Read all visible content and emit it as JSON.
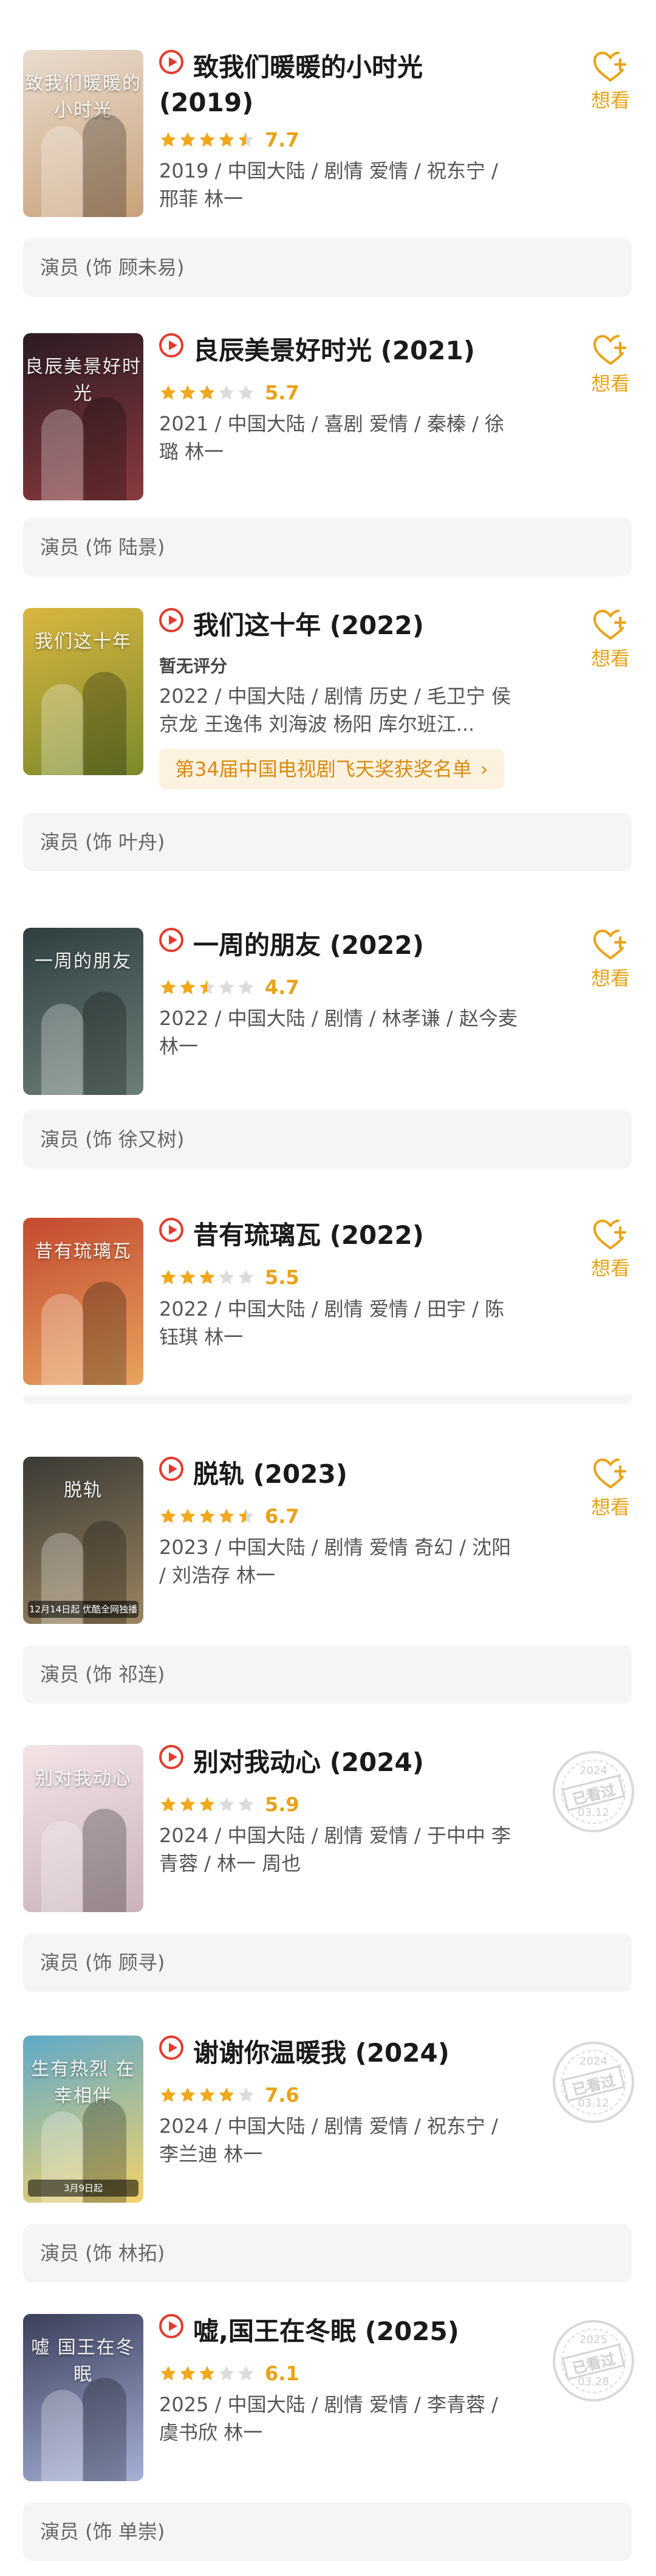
{
  "want_label": "想看",
  "items": [
    {
      "title": "致我们暖暖的小时光(2019)",
      "stars": [
        1,
        1,
        1,
        1,
        0.5
      ],
      "score": "7.7",
      "meta": "2019 / 中国大陆 / 剧情 爱情 / 祝东宁 / 邢菲 林一",
      "status": "want",
      "role": "演员 (饰 顾未易)",
      "poster_colors": [
        "#e9dccf",
        "#c9a27a"
      ],
      "poster_text": "致我们暖暖的小时光"
    },
    {
      "title": "良辰美景好时光 (2021)",
      "stars": [
        1,
        1,
        1,
        0,
        0
      ],
      "score": "5.7",
      "meta": "2021 / 中国大陆 / 喜剧 爱情 / 秦榛 / 徐璐 林一",
      "status": "want",
      "role": "演员 (饰 陆景)",
      "poster_colors": [
        "#2b1b22",
        "#8a3a3f"
      ],
      "poster_text": "良辰美景好时光"
    },
    {
      "title": "我们这十年 (2022)",
      "no_score": "暂无评分",
      "meta": "2022 / 中国大陆 / 剧情 历史 / 毛卫宁 侯京龙 王逸伟 刘海波 杨阳 库尔班江...",
      "award": "第34届中国电视剧飞天奖获奖名单",
      "status": "want",
      "role": "演员 (饰 叶舟)",
      "poster_colors": [
        "#d9b640",
        "#7a8a2a"
      ],
      "poster_text": "我们这十年"
    },
    {
      "title": "一周的朋友 (2022)",
      "stars": [
        1,
        1,
        0.5,
        0,
        0
      ],
      "score": "4.7",
      "meta": "2022 / 中国大陆 / 剧情 / 林孝谦 / 赵今麦 林一",
      "status": "want",
      "role": "演员 (饰 徐又树)",
      "poster_colors": [
        "#2f3f40",
        "#6d7f7a"
      ],
      "poster_text": "一周的朋友"
    },
    {
      "title": "昔有琉璃瓦 (2022)",
      "stars": [
        1,
        1,
        1,
        0,
        0
      ],
      "score": "5.5",
      "meta": "2022 / 中国大陆 / 剧情 爱情 / 田宇 / 陈钰琪 林一",
      "status": "want",
      "role": "",
      "poster_colors": [
        "#c44a2f",
        "#e7a35e"
      ],
      "poster_text": "昔有琉璃瓦"
    },
    {
      "title": "脱轨 (2023)",
      "stars": [
        1,
        1,
        1,
        1,
        0.5
      ],
      "score": "6.7",
      "meta": "2023 / 中国大陆 / 剧情 爱情 奇幻 / 沈阳 / 刘浩存 林一",
      "status": "want",
      "role": "演员 (饰 祁连)",
      "poster_colors": [
        "#3b3a36",
        "#9b8560"
      ],
      "poster_text": "脱轨",
      "poster_badge": "12月14日起 优酷全网独播"
    },
    {
      "title": "别对我动心 (2024)",
      "stars": [
        1,
        1,
        1,
        0,
        0
      ],
      "score": "5.9",
      "meta": "2024 / 中国大陆 / 剧情 爱情 / 于中中 李青蓉 / 林一 周也",
      "status": "watched",
      "stamp": {
        "year": "2024",
        "label": "已看过",
        "date": "03.12"
      },
      "role": "演员 (饰 顾寻)",
      "poster_colors": [
        "#f3e4e6",
        "#c9b3b9"
      ],
      "poster_text": "别对我动心"
    },
    {
      "title": "谢谢你温暖我 (2024)",
      "stars": [
        1,
        1,
        1,
        1,
        0
      ],
      "score": "7.6",
      "meta": "2024 / 中国大陆 / 剧情 爱情 / 祝东宁 / 李兰迪 林一",
      "status": "watched",
      "stamp": {
        "year": "2024",
        "label": "已看过",
        "date": "03.12"
      },
      "role": "演员 (饰 林拓)",
      "poster_colors": [
        "#5fa9c9",
        "#f3d36a"
      ],
      "poster_text": "生有热烈 在幸相伴",
      "poster_badge": "3月9日起"
    },
    {
      "title": "嘘,国王在冬眠 (2025)",
      "stars": [
        1,
        1,
        1,
        0,
        0
      ],
      "score": "6.1",
      "meta": "2025 / 中国大陆 / 剧情 爱情 / 李青蓉 / 虞书欣 林一",
      "status": "watched",
      "stamp": {
        "year": "2025",
        "label": "已看过",
        "date": "03.28"
      },
      "role": "演员 (饰 单崇)",
      "poster_colors": [
        "#3b3f5a",
        "#a6b0d8"
      ],
      "poster_text": "嘘 国王在冬眠"
    }
  ]
}
